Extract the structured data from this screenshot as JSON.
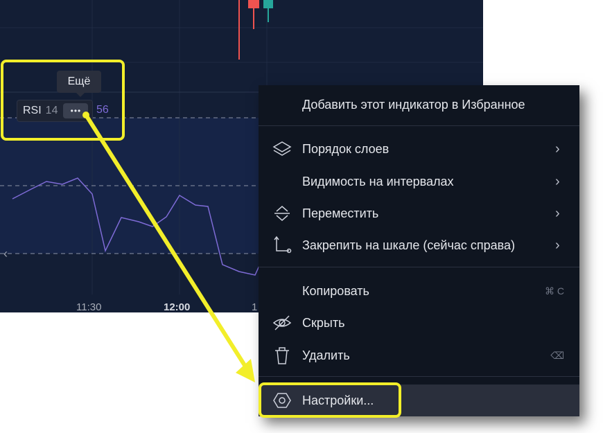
{
  "chart": {
    "indicator_name": "RSI",
    "indicator_param": "14",
    "indicator_value_fragment": "56",
    "more_button_glyph": "•••",
    "tooltip": "Ещё",
    "left_scroll_glyph": "‹",
    "time_labels": [
      "11:30",
      "12:00",
      "1"
    ],
    "rsi_line_color": "#7e6bd6",
    "candle_colors": {
      "down": "#ef5350",
      "up": "#26a69a"
    }
  },
  "menu": {
    "items": [
      {
        "label": "Добавить этот индикатор в Избранное",
        "icon": "",
        "submenu": false,
        "shortcut": ""
      },
      {
        "label": "Порядок слоев",
        "icon": "layers-icon",
        "submenu": true,
        "shortcut": ""
      },
      {
        "label": "Видимость на интервалах",
        "icon": "",
        "submenu": true,
        "shortcut": ""
      },
      {
        "label": "Переместить",
        "icon": "move-icon",
        "submenu": true,
        "shortcut": ""
      },
      {
        "label": "Закрепить на шкале (сейчас справа)",
        "icon": "pin-scale-icon",
        "submenu": true,
        "shortcut": ""
      },
      {
        "label": "Копировать",
        "icon": "",
        "submenu": false,
        "shortcut": "⌘ C"
      },
      {
        "label": "Скрыть",
        "icon": "eye-off-icon",
        "submenu": false,
        "shortcut": ""
      },
      {
        "label": "Удалить",
        "icon": "trash-icon",
        "submenu": false,
        "shortcut": "⌫"
      },
      {
        "label": "Настройки...",
        "icon": "settings-hex-icon",
        "submenu": false,
        "shortcut": ""
      }
    ],
    "arrow_glyph": "›"
  },
  "annotation": {
    "highlight_color": "#f2ee2a"
  }
}
